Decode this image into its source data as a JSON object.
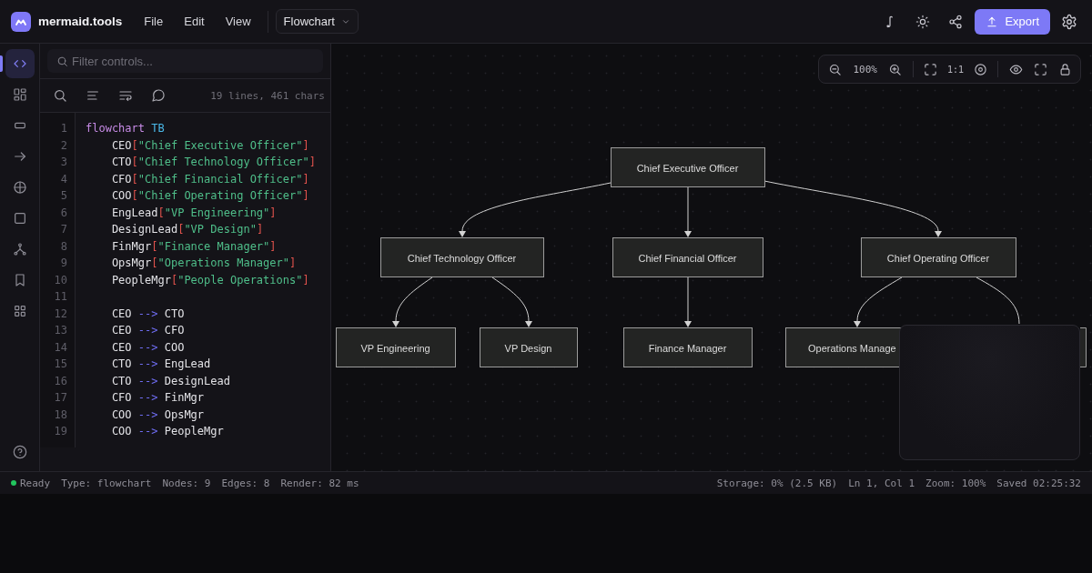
{
  "app": {
    "name": "mermaid.tools"
  },
  "menu": [
    {
      "label": "File"
    },
    {
      "label": "Edit"
    },
    {
      "label": "View"
    }
  ],
  "diagram_type": {
    "value": "Flowchart"
  },
  "actions": {
    "export": "Export"
  },
  "sidebar": {
    "items": [
      {
        "selected": true
      },
      {
        "selected": false
      },
      {
        "selected": false
      },
      {
        "selected": false
      },
      {
        "selected": false
      },
      {
        "selected": false
      },
      {
        "selected": false
      },
      {
        "selected": false
      },
      {
        "selected": false
      }
    ]
  },
  "editor": {
    "filter": {
      "placeholder": "Filter controls..."
    },
    "stats": "19 lines, 461 chars",
    "lines": [
      {
        "number": "1",
        "tokens": [
          {
            "kind": "keyword",
            "text": "flowchart"
          },
          {
            "kind": "direction",
            "text": " TB"
          }
        ]
      },
      {
        "number": "2",
        "tokens": [
          {
            "kind": "id",
            "text": "    CEO"
          },
          {
            "kind": "bracket",
            "text": "["
          },
          {
            "kind": "string",
            "text": "\"Chief Executive Officer\""
          },
          {
            "kind": "bracket",
            "text": "]"
          }
        ]
      },
      {
        "number": "3",
        "tokens": [
          {
            "kind": "id",
            "text": "    CTO"
          },
          {
            "kind": "bracket",
            "text": "["
          },
          {
            "kind": "string",
            "text": "\"Chief Technology Officer\""
          },
          {
            "kind": "bracket",
            "text": "]"
          }
        ]
      },
      {
        "number": "4",
        "tokens": [
          {
            "kind": "id",
            "text": "    CFO"
          },
          {
            "kind": "bracket",
            "text": "["
          },
          {
            "kind": "string",
            "text": "\"Chief Financial Officer\""
          },
          {
            "kind": "bracket",
            "text": "]"
          }
        ]
      },
      {
        "number": "5",
        "tokens": [
          {
            "kind": "id",
            "text": "    COO"
          },
          {
            "kind": "bracket",
            "text": "["
          },
          {
            "kind": "string",
            "text": "\"Chief Operating Officer\""
          },
          {
            "kind": "bracket",
            "text": "]"
          }
        ]
      },
      {
        "number": "6",
        "tokens": [
          {
            "kind": "id",
            "text": "    EngLead"
          },
          {
            "kind": "bracket",
            "text": "["
          },
          {
            "kind": "string",
            "text": "\"VP Engineering\""
          },
          {
            "kind": "bracket",
            "text": "]"
          }
        ]
      },
      {
        "number": "7",
        "tokens": [
          {
            "kind": "id",
            "text": "    DesignLead"
          },
          {
            "kind": "bracket",
            "text": "["
          },
          {
            "kind": "string",
            "text": "\"VP Design\""
          },
          {
            "kind": "bracket",
            "text": "]"
          }
        ]
      },
      {
        "number": "8",
        "tokens": [
          {
            "kind": "id",
            "text": "    FinMgr"
          },
          {
            "kind": "bracket",
            "text": "["
          },
          {
            "kind": "string",
            "text": "\"Finance Manager\""
          },
          {
            "kind": "bracket",
            "text": "]"
          }
        ]
      },
      {
        "number": "9",
        "tokens": [
          {
            "kind": "id",
            "text": "    OpsMgr"
          },
          {
            "kind": "bracket",
            "text": "["
          },
          {
            "kind": "string",
            "text": "\"Operations Manager\""
          },
          {
            "kind": "bracket",
            "text": "]"
          }
        ]
      },
      {
        "number": "10",
        "tokens": [
          {
            "kind": "id",
            "text": "    PeopleMgr"
          },
          {
            "kind": "bracket",
            "text": "["
          },
          {
            "kind": "string",
            "text": "\"People Operations\""
          },
          {
            "kind": "bracket",
            "text": "]"
          }
        ]
      },
      {
        "number": "11"
      },
      {
        "number": "12",
        "tokens": [
          {
            "kind": "id",
            "text": "    CEO"
          },
          {
            "kind": "arrow",
            "text": " --> "
          },
          {
            "kind": "id",
            "text": "CTO"
          }
        ]
      },
      {
        "number": "13",
        "tokens": [
          {
            "kind": "id",
            "text": "    CEO"
          },
          {
            "kind": "arrow",
            "text": " --> "
          },
          {
            "kind": "id",
            "text": "CFO"
          }
        ]
      },
      {
        "number": "14",
        "tokens": [
          {
            "kind": "id",
            "text": "    CEO"
          },
          {
            "kind": "arrow",
            "text": " --> "
          },
          {
            "kind": "id",
            "text": "COO"
          }
        ]
      },
      {
        "number": "15",
        "tokens": [
          {
            "kind": "id",
            "text": "    CTO"
          },
          {
            "kind": "arrow",
            "text": " --> "
          },
          {
            "kind": "id",
            "text": "EngLead"
          }
        ]
      },
      {
        "number": "16",
        "tokens": [
          {
            "kind": "id",
            "text": "    CTO"
          },
          {
            "kind": "arrow",
            "text": " --> "
          },
          {
            "kind": "id",
            "text": "DesignLead"
          }
        ]
      },
      {
        "number": "17",
        "tokens": [
          {
            "kind": "id",
            "text": "    CFO"
          },
          {
            "kind": "arrow",
            "text": " --> "
          },
          {
            "kind": "id",
            "text": "FinMgr"
          }
        ]
      },
      {
        "number": "18",
        "tokens": [
          {
            "kind": "id",
            "text": "    COO"
          },
          {
            "kind": "arrow",
            "text": " --> "
          },
          {
            "kind": "id",
            "text": "OpsMgr"
          }
        ]
      },
      {
        "number": "19",
        "tokens": [
          {
            "kind": "id",
            "text": "    COO"
          },
          {
            "kind": "arrow",
            "text": " --> "
          },
          {
            "kind": "id",
            "text": "PeopleMgr"
          }
        ]
      }
    ]
  },
  "canvas": {
    "toolbar": {
      "zoom": "100%",
      "actual_size": "1:1"
    },
    "nodes": [
      {
        "label": "Chief Executive Officer"
      },
      {
        "label": "Chief Technology Officer"
      },
      {
        "label": "Chief Financial Officer"
      },
      {
        "label": "Chief Operating Officer"
      },
      {
        "label": "VP Engineering"
      },
      {
        "label": "VP Design"
      },
      {
        "label": "Finance Manager"
      },
      {
        "label": "Operations Manage"
      }
    ]
  },
  "status_bar": {
    "left": [
      "Ready",
      "Type: flowchart",
      "Nodes: 9",
      "Edges: 8",
      "Render: 82 ms"
    ],
    "right": [
      "Storage: 0% (2.5 KB)",
      "Ln 1, Col 1",
      "Zoom: 100%",
      "Saved 02:25:32"
    ]
  }
}
